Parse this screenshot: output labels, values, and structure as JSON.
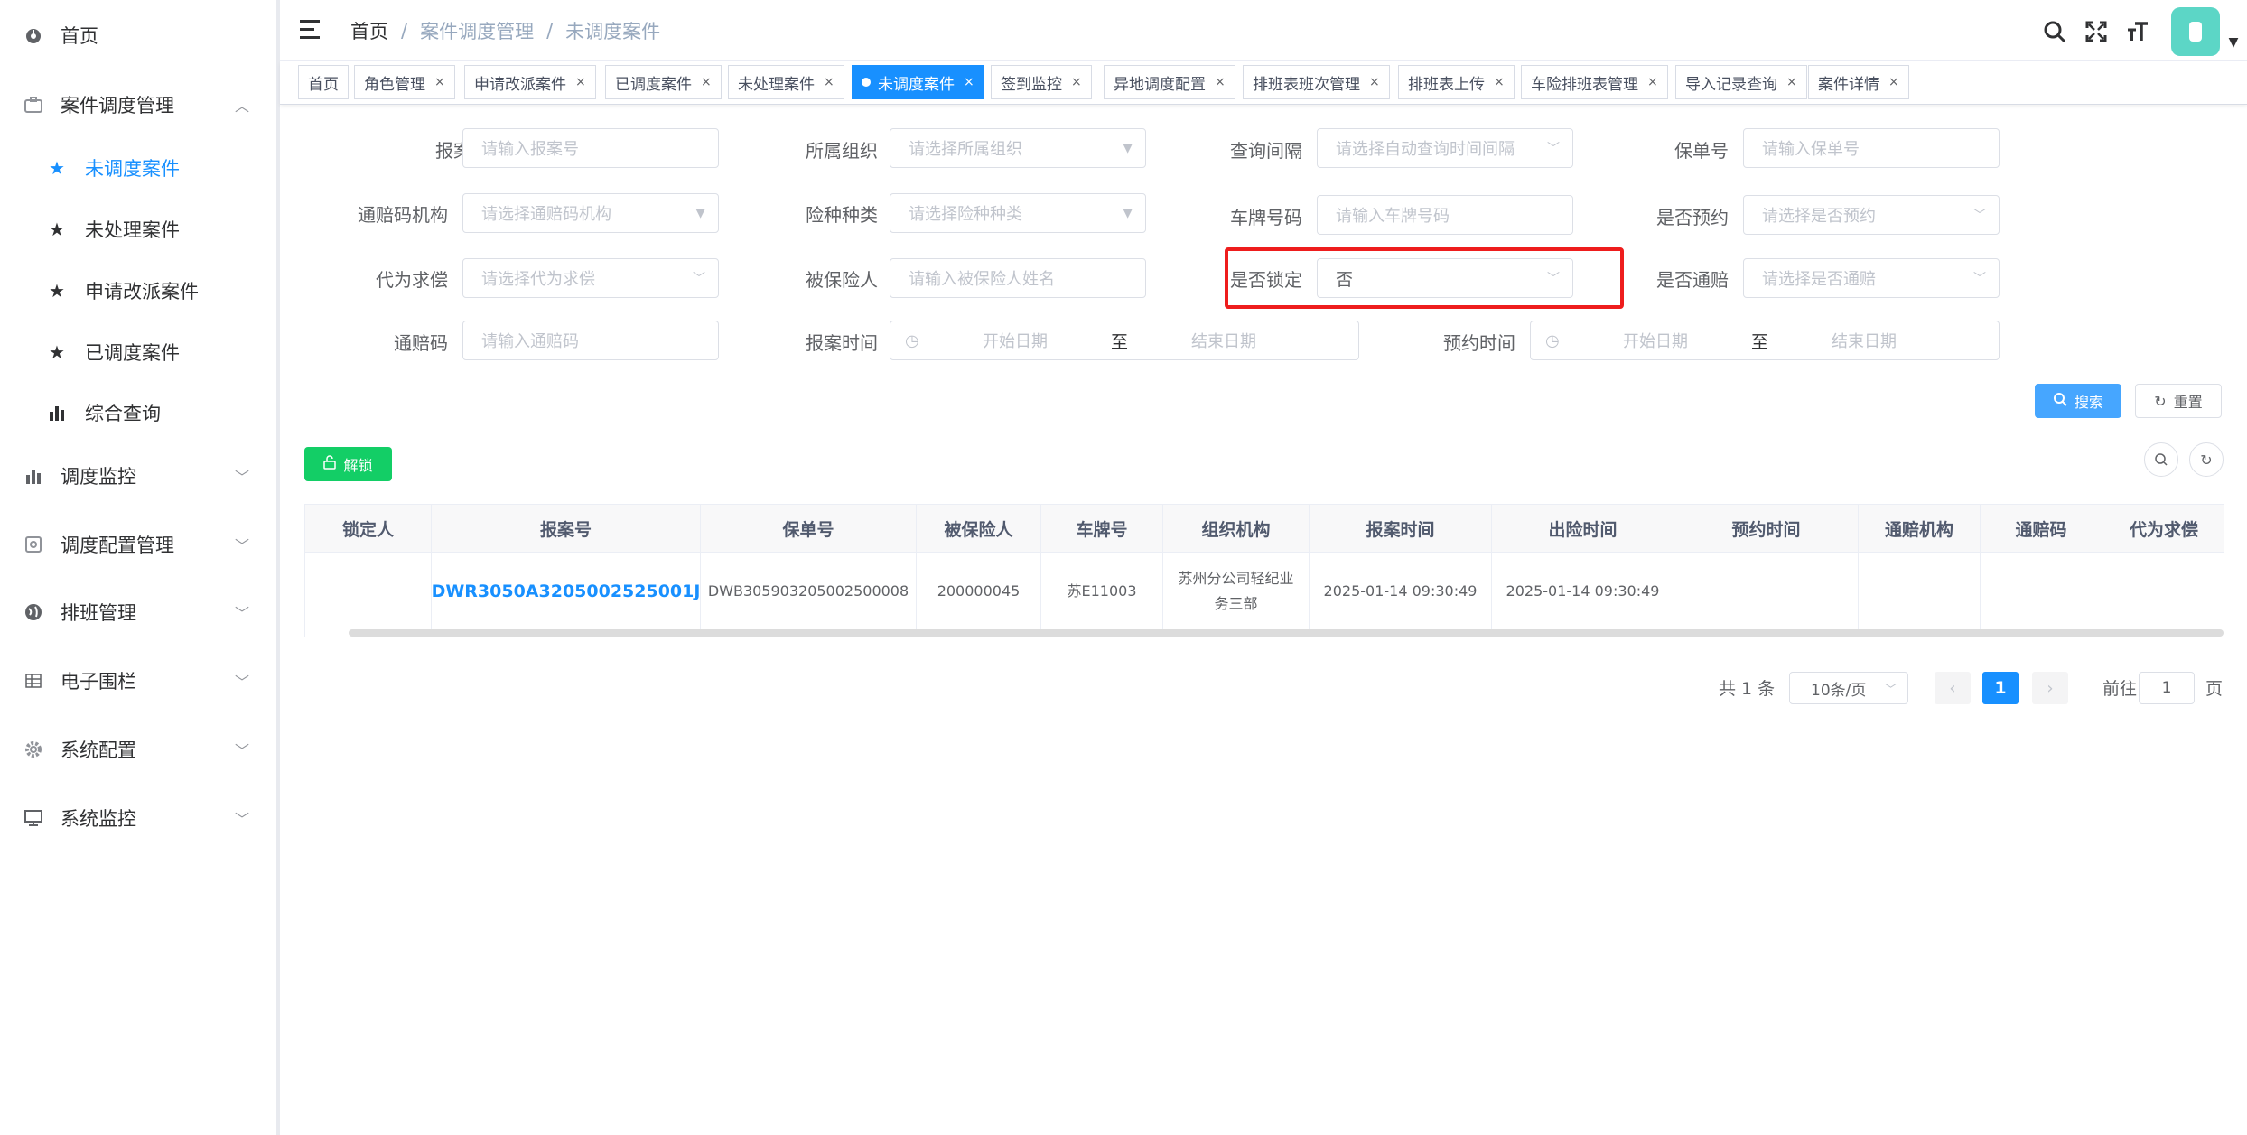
{
  "sidebar": {
    "items": [
      {
        "label": "首页",
        "icon": "dashboard-icon"
      },
      {
        "label": "案件调度管理",
        "icon": "case-icon",
        "expanded": true,
        "children": [
          {
            "label": "未调度案件",
            "icon": "star-icon",
            "active": true
          },
          {
            "label": "未处理案件",
            "icon": "star-icon"
          },
          {
            "label": "申请改派案件",
            "icon": "star-icon"
          },
          {
            "label": "已调度案件",
            "icon": "star-icon"
          },
          {
            "label": "综合查询",
            "icon": "bar-chart-icon"
          }
        ]
      },
      {
        "label": "调度监控",
        "icon": "bar-chart-icon"
      },
      {
        "label": "调度配置管理",
        "icon": "config-icon"
      },
      {
        "label": "排班管理",
        "icon": "globe-icon"
      },
      {
        "label": "电子围栏",
        "icon": "grid-icon"
      },
      {
        "label": "系统配置",
        "icon": "gear-icon"
      },
      {
        "label": "系统监控",
        "icon": "monitor-icon"
      }
    ]
  },
  "header": {
    "breadcrumb": [
      "首页",
      "案件调度管理",
      "未调度案件"
    ],
    "breadcrumb_sep": "/"
  },
  "tags": [
    {
      "label": "首页"
    },
    {
      "label": "角色管理"
    },
    {
      "label": "申请改派案件"
    },
    {
      "label": "已调度案件"
    },
    {
      "label": "未处理案件"
    },
    {
      "label": "未调度案件",
      "active": true
    },
    {
      "label": "签到监控"
    },
    {
      "label": "异地调度配置"
    },
    {
      "label": "排班表班次管理"
    },
    {
      "label": "排班表上传"
    },
    {
      "label": "车险排班表管理"
    },
    {
      "label": "导入记录查询"
    },
    {
      "label": "案件详情"
    }
  ],
  "form": {
    "report_no": {
      "label": "报案号",
      "placeholder": "请输入报案号"
    },
    "org": {
      "label": "所属组织",
      "placeholder": "请选择所属组织"
    },
    "query_interval": {
      "label": "查询间隔",
      "placeholder": "请选择自动查询时间间隔"
    },
    "policy_no": {
      "label": "保单号",
      "placeholder": "请输入保单号"
    },
    "pass_org": {
      "label": "通赔码机构",
      "placeholder": "请选择通赔码机构"
    },
    "insurance_type": {
      "label": "险种种类",
      "placeholder": "请选择险种种类"
    },
    "plate_no": {
      "label": "车牌号码",
      "placeholder": "请输入车牌号码"
    },
    "is_reserved": {
      "label": "是否预约",
      "placeholder": "请选择是否预约"
    },
    "proxy_claim": {
      "label": "代为求偿",
      "placeholder": "请选择代为求偿"
    },
    "insured": {
      "label": "被保险人",
      "placeholder": "请输入被保险人姓名"
    },
    "is_locked": {
      "label": "是否锁定",
      "value": "否"
    },
    "is_pass": {
      "label": "是否通赔",
      "placeholder": "请选择是否通赔"
    },
    "pass_code": {
      "label": "通赔码",
      "placeholder": "请输入通赔码"
    },
    "report_time": {
      "label": "报案时间",
      "start": "开始日期",
      "to": "至",
      "end": "结束日期"
    },
    "reserve_time": {
      "label": "预约时间",
      "start": "开始日期",
      "to": "至",
      "end": "结束日期"
    }
  },
  "buttons": {
    "search": "搜索",
    "reset": "重置",
    "unlock": "解锁"
  },
  "table": {
    "columns": [
      "锁定人",
      "报案号",
      "保单号",
      "被保险人",
      "车牌号",
      "组织机构",
      "报案时间",
      "出险时间",
      "预约时间",
      "通赔机构",
      "通赔码",
      "代为求偿"
    ],
    "rows": [
      [
        "",
        "DWR3050A3205002525001J",
        "DWB3059032050025000​08",
        "200000045",
        "苏E11003",
        "苏州分公司轻纪业务三部",
        "2025-01-14 09:30:49",
        "2025-01-14 09:30:49",
        "",
        "",
        "",
        ""
      ]
    ]
  },
  "pagination": {
    "total": "共 1 条",
    "page_size": "10条/页",
    "prev": "‹",
    "current": "1",
    "next": "›",
    "jump_prefix": "前往",
    "jump_value": "1",
    "jump_suffix": "页"
  },
  "colors": {
    "primary": "#1890ff",
    "success": "#13ce66",
    "highlight": "#ee1d1d"
  }
}
